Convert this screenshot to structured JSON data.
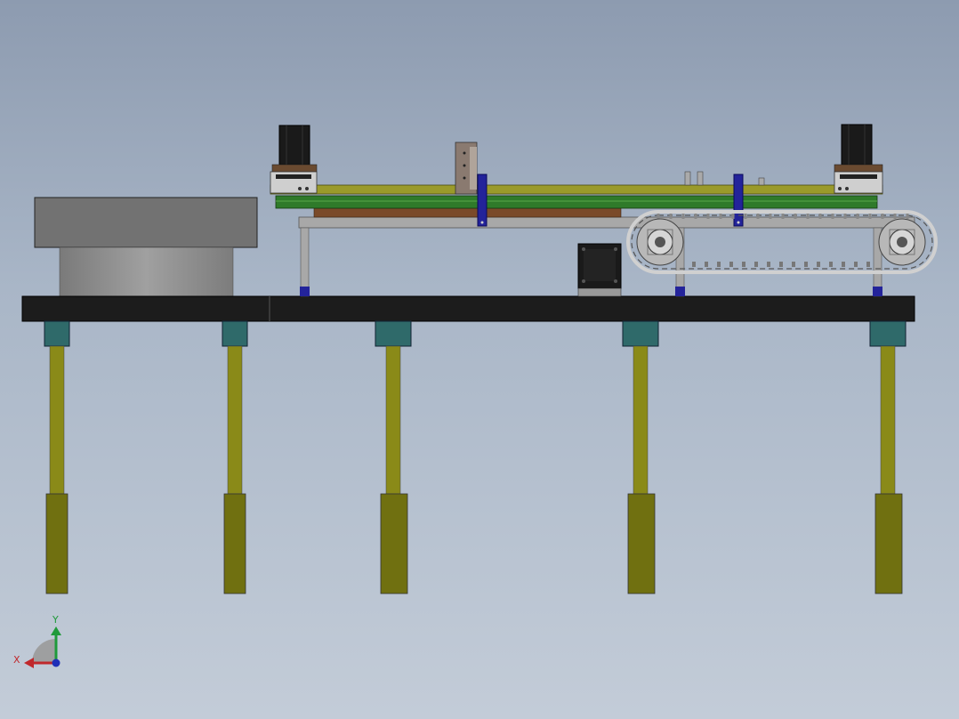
{
  "triad": {
    "x_label": "X",
    "y_label": "Y",
    "x_color": "#c0282c",
    "y_color": "#1f9a3a",
    "z_color": "#1f2fb8"
  },
  "colors": {
    "background_top": "#8d9bb0",
    "background_bottom": "#c3ccd8",
    "table_top": "#1c1c1c",
    "leg_rod": "#8a8a18",
    "leg_sleeve": "#707010",
    "leg_block": "#2f6a6a",
    "motor": "#1a1a1a",
    "rail_yellow": "#9a9a2a",
    "rail_green": "#2f7a2a",
    "wood_plate": "#7a4a2a",
    "frame_grey": "#a8a8a8",
    "bracket_blue": "#23239a",
    "chain": "#c8c8c8",
    "box_dark": "#6e6e6e",
    "box_light": "#9a9a9a"
  },
  "icons": [
    "coordinate-triad-icon"
  ]
}
